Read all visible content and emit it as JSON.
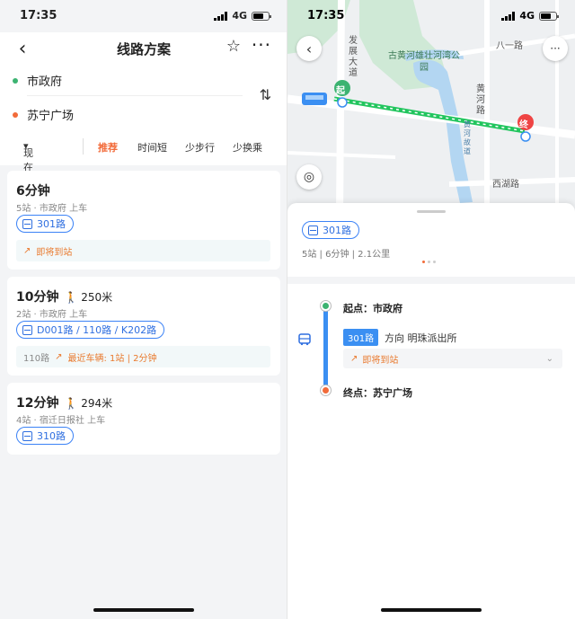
{
  "status": {
    "time": "17:35",
    "network": "4G"
  },
  "left": {
    "title": "线路方案",
    "origin": "市政府",
    "destination": "苏宁广场",
    "filters": {
      "depart": "现在出发",
      "options": [
        "推荐",
        "时间短",
        "少步行",
        "少换乘"
      ],
      "selected": "推荐"
    },
    "routes": [
      {
        "duration": "6分钟",
        "walk": "",
        "detail": "5站 · 市政府 上车",
        "lines": "301路",
        "live_prefix": "",
        "live": "即将到站"
      },
      {
        "duration": "10分钟",
        "walk": "250米",
        "detail": "2站 · 市政府 上车",
        "lines": "D001路 / 110路 / K202路",
        "live_prefix": "110路",
        "live": "最近车辆: 1站 | 2分钟"
      },
      {
        "duration": "12分钟",
        "walk": "294米",
        "detail": "4站 · 宿迁日报社 上车",
        "lines": "310路",
        "live_prefix": "",
        "live": ""
      }
    ]
  },
  "right": {
    "map_labels": {
      "road_fazhan": "发展大道",
      "park": "古黄河雄壮河湾公园",
      "yiyi": "八一路",
      "huanghe_road": "黄河路",
      "huanghe_gudao": "黄河故道",
      "xihu": "西湖路",
      "start_marker": "起",
      "end_marker": "终"
    },
    "route_line": "301路",
    "route_info": "5站 | 6分钟 | 2.1公里",
    "start_label": "起点：市政府",
    "end_label": "终点：苏宁广场",
    "direction": "方向 明珠派出所",
    "arrival": "即将到站"
  },
  "colors": {
    "accent": "#f26b3a",
    "blue": "#3b8ff2",
    "green": "#3cb371",
    "route_green": "#22c55e"
  }
}
